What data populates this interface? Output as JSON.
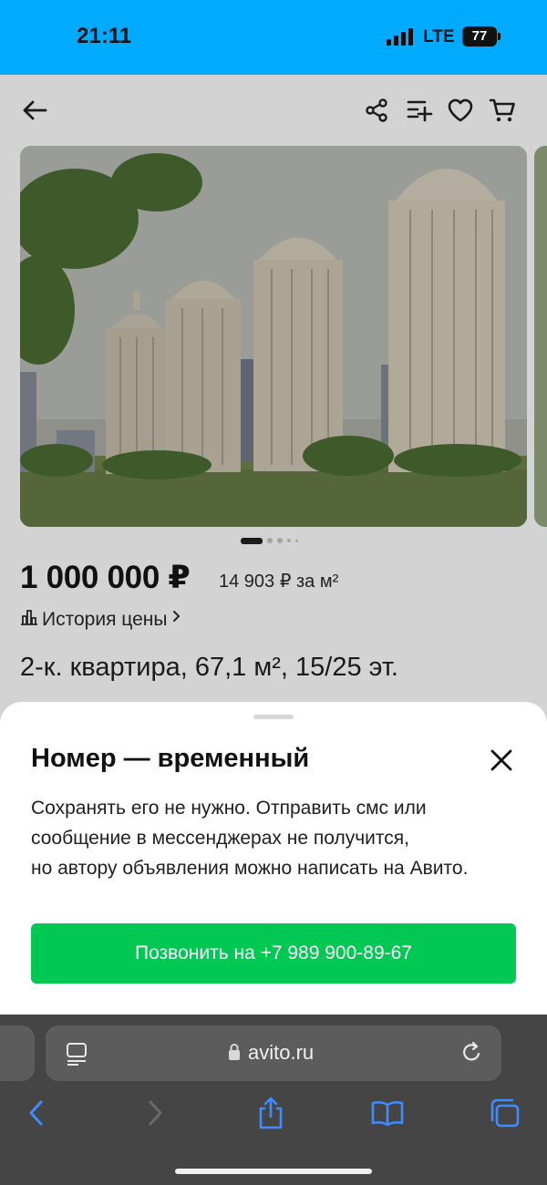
{
  "status_bar": {
    "time": "21:11",
    "network": "LTE",
    "battery": "77",
    "background_color": "#00aaff"
  },
  "listing_header": {
    "icons": [
      "back-arrow-icon",
      "share-icon",
      "compare-icon",
      "heart-icon",
      "cart-icon"
    ]
  },
  "listing": {
    "photo_description_icon": "building-photo",
    "gallery": {
      "total_slides": 5,
      "active_slide": 1
    },
    "price": "1 000 000 ₽",
    "price_per_m": "14 903 ₽ за м²",
    "price_history_label": "История цены",
    "title": "2-к. квартира, 67,1 м², 15/25 эт."
  },
  "sheet": {
    "title": "Номер — временный",
    "lines": [
      "Сохранять его не нужно. Отправить смс или",
      "сообщение в мессенджерах не получится,",
      "но автору объявления можно написать на Авито."
    ],
    "call_button": "Позвонить на +7 989 900-89-67",
    "call_button_color": "#00c853"
  },
  "browser": {
    "url": "avito.ru",
    "toolbar_icons": [
      "back-icon",
      "forward-icon",
      "share-icon",
      "bookmarks-icon",
      "tabs-icon"
    ],
    "accent_color": "#3f8cff"
  }
}
